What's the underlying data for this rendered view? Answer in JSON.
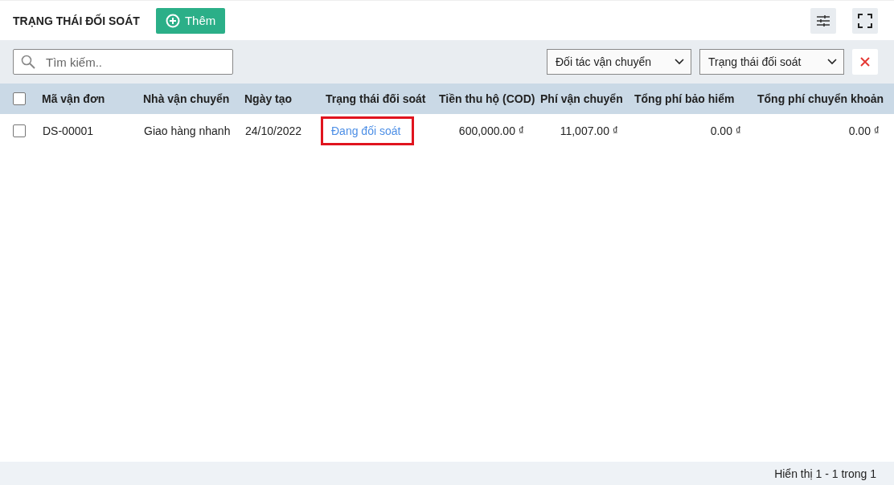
{
  "header": {
    "title": "TRẠNG THÁI ĐỐI SOÁT",
    "add_button": "Thêm"
  },
  "filters": {
    "search": {
      "placeholder": "Tìm kiếm.."
    },
    "dropdowns": [
      "Đối tác vận chuyển",
      "Trạng thái đối soát"
    ]
  },
  "table": {
    "columns": [
      "Mã vận đơn",
      "Nhà vận chuyển",
      "Ngày tạo",
      "Trạng thái đối soát",
      "Tiền thu hộ (COD)",
      "Phí vận chuyển",
      "Tổng phí bảo hiểm",
      "Tổng phí chuyển khoản"
    ],
    "all_checked": false,
    "rows": [
      {
        "checked": false,
        "highlighted": true,
        "cells": [
          "DS-00001",
          "Giao hàng nhanh",
          "24/10/2022",
          "Đang đối soát",
          "600,000.00 ₫",
          "11,007.00 ₫",
          "0.00 ₫",
          "0.00 ₫"
        ]
      }
    ]
  },
  "status_bar": "Hiển thị 1 - 1 trong 1"
}
